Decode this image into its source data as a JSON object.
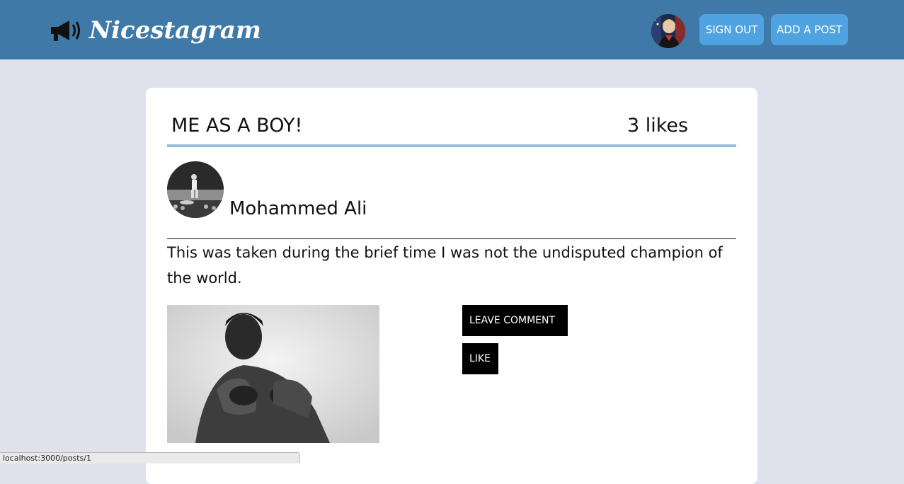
{
  "navbar": {
    "brand_name": "Nicestagram",
    "brand_icon": "megaphone-icon",
    "user_avatar": "user-avatar",
    "sign_out_label": "SIGN OUT",
    "add_post_label": "ADD A POST",
    "accent_color": "#3e79a7",
    "button_color": "#4fa3e0"
  },
  "post": {
    "title": "ME AS A BOY!",
    "likes": "3 likes",
    "author": "Mohammed Ali",
    "body": "This was taken during the brief time I was not the undisputed champion of the world.",
    "actions": {
      "leave_comment_label": "LEAVE COMMENT",
      "like_label": "LIKE"
    }
  },
  "status_bar": {
    "url": "localhost:3000/posts/1"
  }
}
